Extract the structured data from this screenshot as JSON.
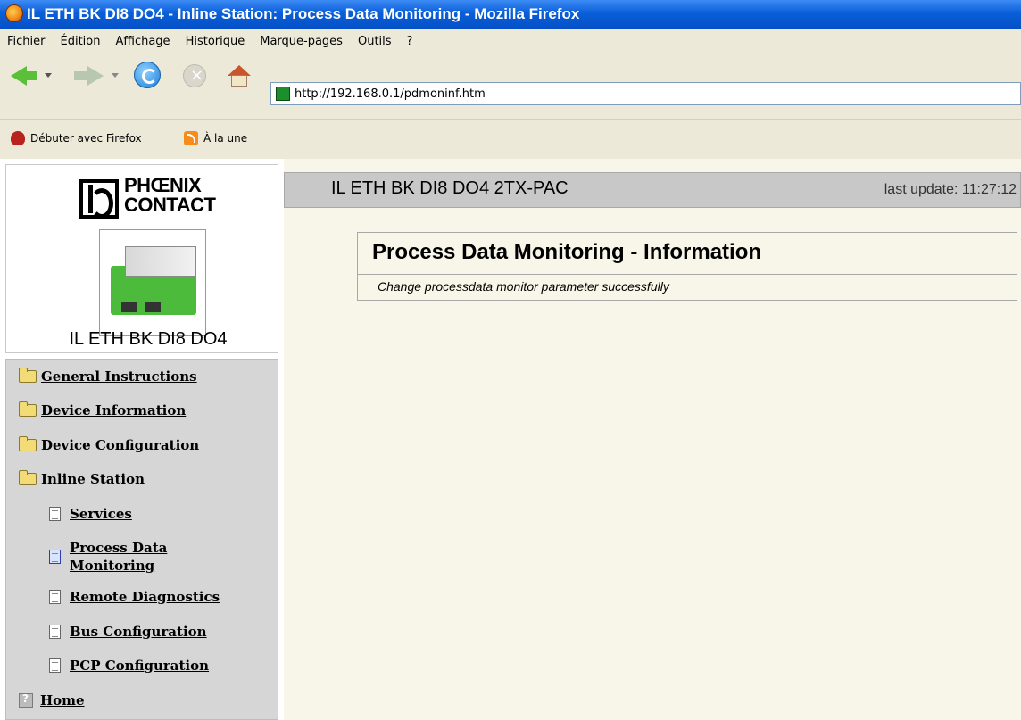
{
  "window": {
    "title": "IL ETH BK DI8 DO4 - Inline Station: Process Data Monitoring - Mozilla Firefox"
  },
  "menubar": {
    "items": [
      "Fichier",
      "Édition",
      "Affichage",
      "Historique",
      "Marque-pages",
      "Outils",
      "?"
    ]
  },
  "toolbar": {
    "url": "http://192.168.0.1/pdmoninf.htm",
    "icons": [
      "back-icon",
      "forward-icon",
      "reload-icon",
      "stop-icon",
      "home-icon"
    ]
  },
  "bookmarks": {
    "items": [
      "Débuter avec Firefox",
      "À la une"
    ]
  },
  "sidebar": {
    "logo_text": "PHŒNIX\nCONTACT",
    "device_name": "IL ETH BK DI8 DO4",
    "items": [
      {
        "label": "General Instructions"
      },
      {
        "label": "Device Information"
      },
      {
        "label": "Device Configuration"
      },
      {
        "label": "Inline Station"
      },
      {
        "label": "Services"
      },
      {
        "label": "Process Data",
        "label2": "Monitoring"
      },
      {
        "label": "Remote Diagnostics"
      },
      {
        "label": "Bus Configuration"
      },
      {
        "label": "PCP Configuration"
      },
      {
        "label": "Home"
      }
    ]
  },
  "header": {
    "title": "IL ETH BK DI8 DO4 2TX-PAC",
    "last_update": "last update: 11:27:12"
  },
  "info": {
    "title": "Process Data Monitoring - Information",
    "message": "Change processdata monitor parameter successfully"
  }
}
